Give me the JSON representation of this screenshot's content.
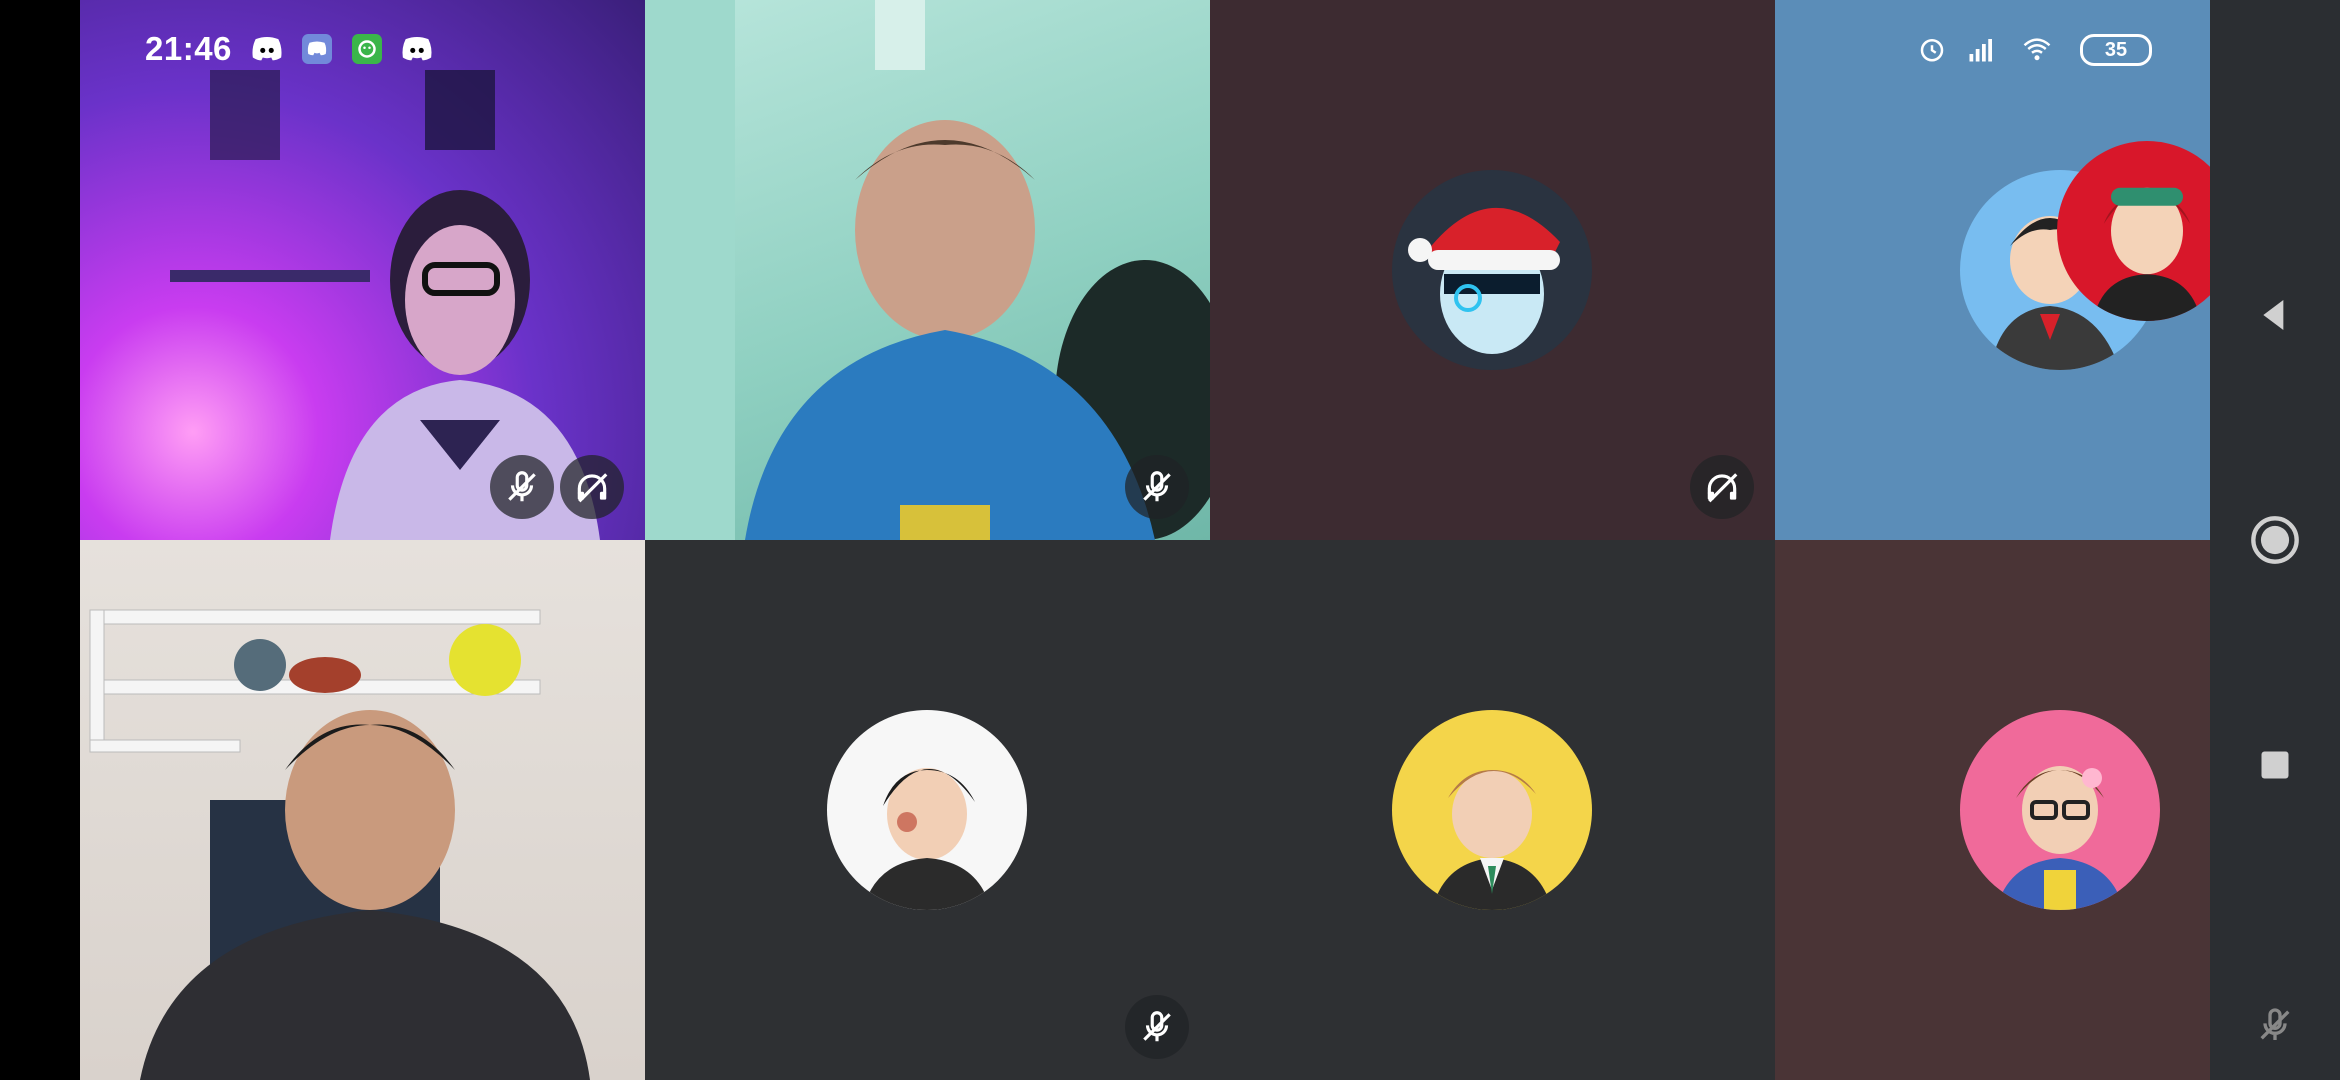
{
  "status_bar": {
    "time": "21:46",
    "left_icons": [
      "discord-icon",
      "discord-badge-icon",
      "green-app-icon",
      "discord-icon"
    ],
    "right_icons": [
      "alarm-icon",
      "signal-icon",
      "wifi-icon"
    ],
    "battery": "35"
  },
  "participants": [
    {
      "kind": "video",
      "scene": "purple-room",
      "muted": true,
      "deafened": true
    },
    {
      "kind": "video",
      "scene": "mint-room",
      "muted": true,
      "deafened": false
    },
    {
      "kind": "avatar",
      "avatar": "santa-robot-avatar",
      "bg": "#3d2b31",
      "muted": false,
      "deafened": true
    },
    {
      "kind": "avatar",
      "avatar": "anime-duo-avatar",
      "bg": "#5b8db8",
      "muted": false,
      "deafened": false
    },
    {
      "kind": "video",
      "scene": "shelf-room",
      "muted": false,
      "deafened": false
    },
    {
      "kind": "avatar",
      "avatar": "anime-boy-avatar",
      "bg": "#2e3033",
      "muted": true,
      "deafened": false
    },
    {
      "kind": "avatar",
      "avatar": "cartoon-guy-avatar",
      "bg": "#2e3033",
      "muted": false,
      "deafened": false
    },
    {
      "kind": "avatar",
      "avatar": "glasses-girl-avatar",
      "bg": "#4a3436",
      "muted": false,
      "deafened": false
    }
  ],
  "colors": {
    "accent_purple": "#7b3fe0",
    "muted_icon": "#ffffff",
    "nav_bar": "#2b2e32"
  },
  "nav_buttons": [
    "back-icon",
    "home-icon",
    "recents-icon"
  ],
  "nav_extra": "mute-icon"
}
